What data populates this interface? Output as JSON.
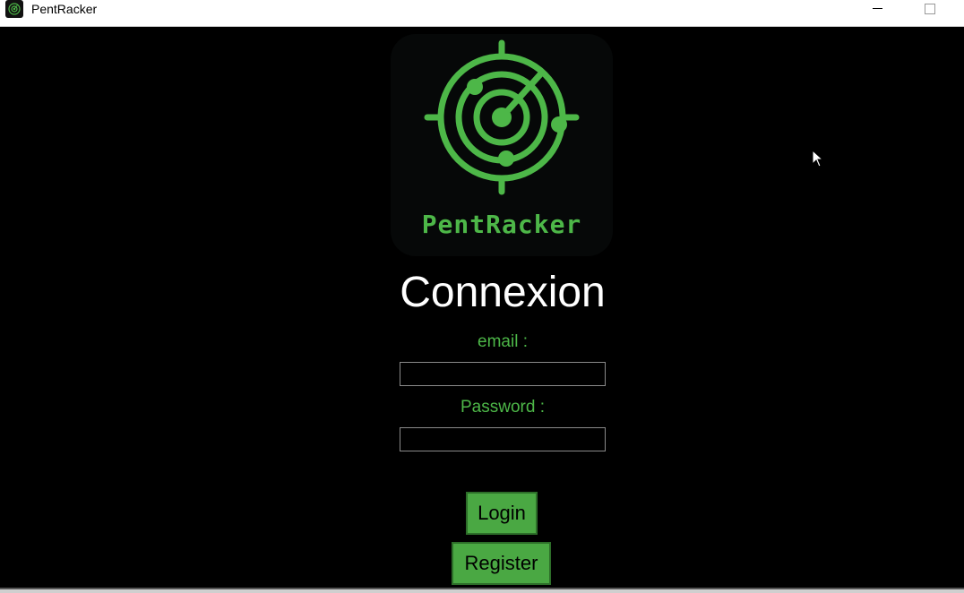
{
  "window": {
    "title": "PentRacker",
    "app_icon": "radar-icon"
  },
  "logo": {
    "text": "PentRacker",
    "icon": "radar-icon",
    "color": "#4db748"
  },
  "form": {
    "heading": "Connexion",
    "email_label": "email :",
    "email_value": "",
    "password_label": "Password :",
    "password_value": "",
    "login_label": "Login",
    "register_label": "Register"
  },
  "colors": {
    "accent": "#4db748",
    "button_bg": "#4aa843",
    "background": "#000000"
  }
}
